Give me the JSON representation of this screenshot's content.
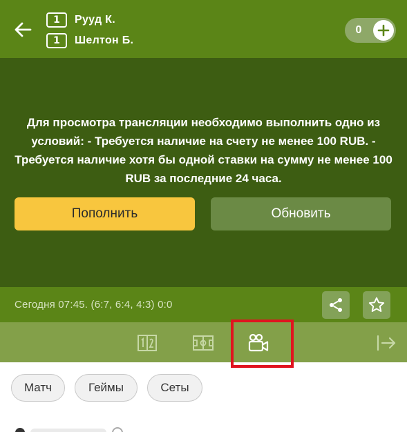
{
  "header": {
    "players": [
      {
        "score": "1",
        "name": "Рууд К."
      },
      {
        "score": "1",
        "name": "Шелтон Б."
      }
    ],
    "bet_count": "0"
  },
  "stream": {
    "message": "Для просмотра трансляции необходимо выполнить одно из условий:  - Требуется наличие на счету не менее 100 RUB.  - Требуется наличие хотя бы одной ставки на сумму не менее 100 RUB за последние 24 часа.",
    "deposit_label": "Пополнить",
    "refresh_label": "Обновить"
  },
  "info": {
    "time_text": "Сегодня 07:45. (6:7, 6:4, 4:3) 0:0"
  },
  "tabs": {
    "icons": [
      "scoreboard-icon",
      "field-icon",
      "video-camera-icon",
      "exit-icon"
    ],
    "active": "video-camera-icon"
  },
  "chips": [
    "Матч",
    "Геймы",
    "Сеты"
  ],
  "colors": {
    "header": "#5b8517",
    "stream_bg": "#3d5d12",
    "deposit": "#f8c63e",
    "refresh": "#6b8a45",
    "tab_bar": "#83a049",
    "highlight": "#e0141f"
  }
}
